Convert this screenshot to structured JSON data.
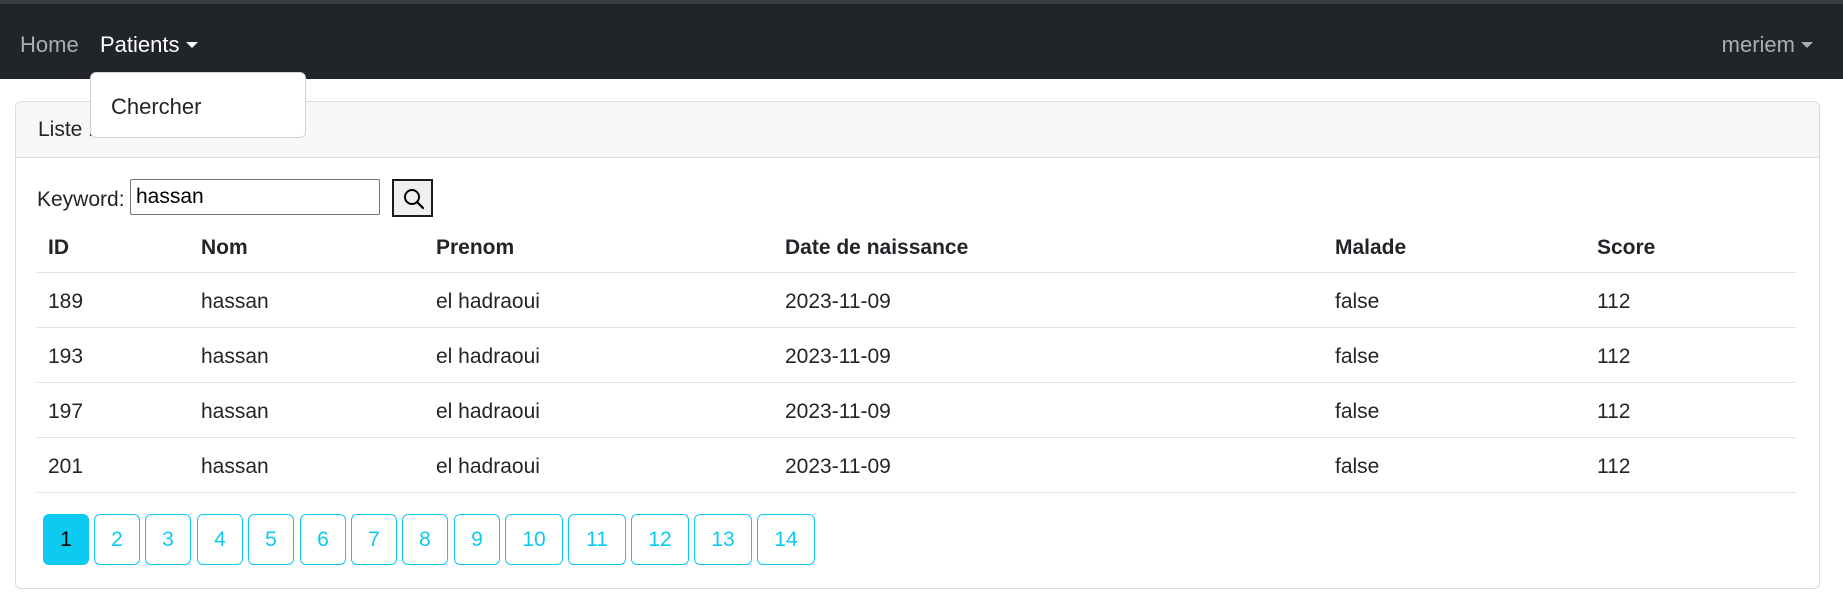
{
  "navbar": {
    "home": "Home",
    "patients": "Patients",
    "user": "meriem",
    "dropdown_items": [
      "Chercher"
    ]
  },
  "card": {
    "title": "Liste Patients"
  },
  "search": {
    "label": "Keyword:",
    "value": "hassan",
    "icon": "search-icon"
  },
  "table": {
    "headers": [
      "ID",
      "Nom",
      "Prenom",
      "Date de naissance",
      "Malade",
      "Score"
    ],
    "rows": [
      [
        "189",
        "hassan",
        "el hadraoui",
        "2023-11-09",
        "false",
        "112"
      ],
      [
        "193",
        "hassan",
        "el hadraoui",
        "2023-11-09",
        "false",
        "112"
      ],
      [
        "197",
        "hassan",
        "el hadraoui",
        "2023-11-09",
        "false",
        "112"
      ],
      [
        "201",
        "hassan",
        "el hadraoui",
        "2023-11-09",
        "false",
        "112"
      ]
    ]
  },
  "pagination": {
    "pages": [
      "1",
      "2",
      "3",
      "4",
      "5",
      "6",
      "7",
      "8",
      "9",
      "10",
      "11",
      "12",
      "13",
      "14"
    ],
    "active": "1"
  },
  "colors": {
    "navbar": "#212529",
    "accent": "#0dcaf0"
  }
}
